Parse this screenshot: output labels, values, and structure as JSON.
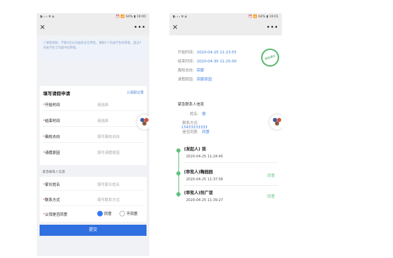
{
  "status_bar": {
    "left": "▮ᵢₗ ᵢₗ ᵢₗ ⊚ ψ",
    "left_phone_right": "⏰ 📶 64% ▮ 19:00",
    "right_phone_right": "⏰ 📶 64% ▮ 19:01"
  },
  "nav": {
    "close": "×",
    "more": "•••"
  },
  "leave_form": {
    "notice": "ⓘ请假须知：学期3天以内由班主任审批，请假3-7天由学生科审批，超过7天由学生工作副书记审批。",
    "title": "填写请假申请",
    "record_link": "☷请假记录",
    "fields": [
      {
        "label": "开始时间",
        "placeholder": "请选择"
      },
      {
        "label": "结束时间",
        "placeholder": "请选择"
      },
      {
        "label": "离校去向",
        "placeholder": "填写离校去向"
      },
      {
        "label": "请假原因",
        "placeholder": "填写请假原因"
      }
    ],
    "contact_caption": "紧急联系人信息",
    "contact_fields": [
      {
        "label": "家长姓名",
        "placeholder": "填写家长姓名"
      },
      {
        "label": "联系方式",
        "placeholder": "填写联系方式"
      }
    ],
    "consent": {
      "label": "父母是否同意",
      "agree": "同意",
      "disagree": "不同意",
      "selected": "同意"
    },
    "submit": "提交",
    "required_mark": "*"
  },
  "leave_detail": {
    "info": [
      {
        "key": "开始时间:",
        "value": "2020-04-25 11:23:55"
      },
      {
        "key": "结束时间:",
        "value": "2020-04-30 11:25:00"
      },
      {
        "key": "离校去向:",
        "value": "回家"
      },
      {
        "key": "请假原因:",
        "value": "回家原因"
      }
    ],
    "stamp": "审批通过",
    "contact_title": "紧急联系人信息",
    "contact": [
      {
        "key": "姓名:",
        "value": "傻"
      },
      {
        "key": "联系方式:",
        "value": "13433333333"
      },
      {
        "key": "是否同意:",
        "value": "同意"
      }
    ],
    "timeline": [
      {
        "name": "(发起人) 我",
        "time": "2020-04-25 11:24:45",
        "status": ""
      },
      {
        "name": "(审批人)鞠园园",
        "time": "2020-04-25 11:37:58",
        "status": "同意"
      },
      {
        "name": "(审批人)别广谊",
        "time": "2020-04-25 11:39:27",
        "status": "同意"
      }
    ]
  },
  "colors": {
    "primary": "#2f6fe0",
    "link": "#3f7ee0",
    "success": "#5ec27f",
    "required": "#e0403d"
  }
}
